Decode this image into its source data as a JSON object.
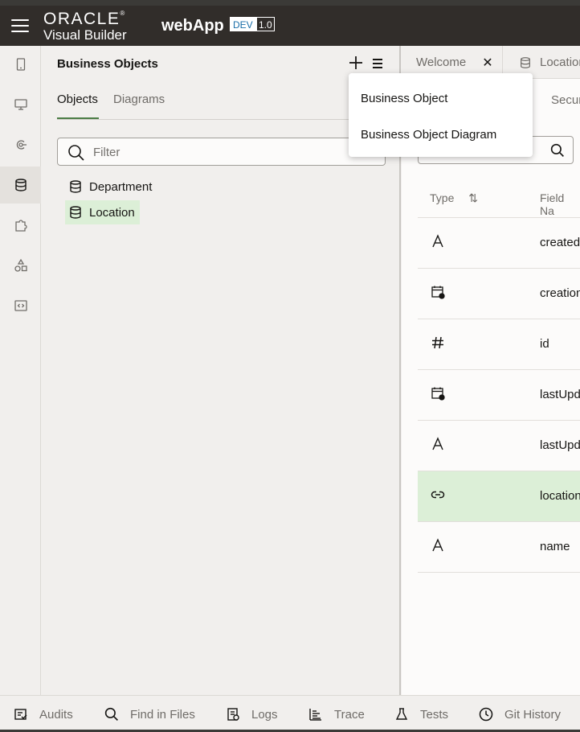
{
  "header": {
    "logo_oracle": "ORACLE",
    "logo_product": "Visual Builder",
    "app_name": "webApp",
    "env_badge": "DEV",
    "version_badge": "1.0"
  },
  "rail": {
    "items": [
      {
        "icon": "mobile-icon",
        "active": false
      },
      {
        "icon": "desktop-icon",
        "active": false
      },
      {
        "icon": "service-connections-icon",
        "active": false
      },
      {
        "icon": "database-icon",
        "active": true
      },
      {
        "icon": "puzzle-icon",
        "active": false
      },
      {
        "icon": "components-icon",
        "active": false
      },
      {
        "icon": "source-code-icon",
        "active": false
      }
    ]
  },
  "left_panel": {
    "title": "Business Objects",
    "tabs": [
      {
        "label": "Objects",
        "active": true
      },
      {
        "label": "Diagrams",
        "active": false
      }
    ],
    "filter_placeholder": "Filter",
    "objects": [
      {
        "label": "Department",
        "selected": false
      },
      {
        "label": "Location",
        "selected": true
      }
    ]
  },
  "add_menu": {
    "items": [
      "Business Object",
      "Business Object Diagram"
    ]
  },
  "editor": {
    "tabs": [
      {
        "label": "Welcome",
        "closable": true
      },
      {
        "label": "Location",
        "closable": false
      }
    ],
    "subtab_partial": "Secur",
    "table": {
      "headers": [
        "Type",
        "Field Na"
      ],
      "rows": [
        {
          "type_icon": "A",
          "field": "created",
          "selected": false
        },
        {
          "type_icon": "calendar-icon",
          "field": "creation",
          "selected": false
        },
        {
          "type_icon": "#",
          "field": "id",
          "selected": false
        },
        {
          "type_icon": "calendar-icon",
          "field": "lastUpd",
          "selected": false
        },
        {
          "type_icon": "A",
          "field": "lastUpd",
          "selected": false
        },
        {
          "type_icon": "link-icon",
          "field": "location",
          "selected": true
        },
        {
          "type_icon": "A",
          "field": "name",
          "selected": false
        }
      ]
    }
  },
  "footer": {
    "items": [
      {
        "label": "Audits",
        "icon": "audits-icon"
      },
      {
        "label": "Find in Files",
        "icon": "search-icon"
      },
      {
        "label": "Logs",
        "icon": "logs-icon"
      },
      {
        "label": "Trace",
        "icon": "trace-icon"
      },
      {
        "label": "Tests",
        "icon": "flask-icon"
      },
      {
        "label": "Git History",
        "icon": "clock-icon"
      }
    ]
  },
  "colors": {
    "header_bg": "#312d2a",
    "selection_green": "#dcefd7",
    "active_tab_underline": "#4c7d46",
    "panel_bg": "#f1efed"
  }
}
